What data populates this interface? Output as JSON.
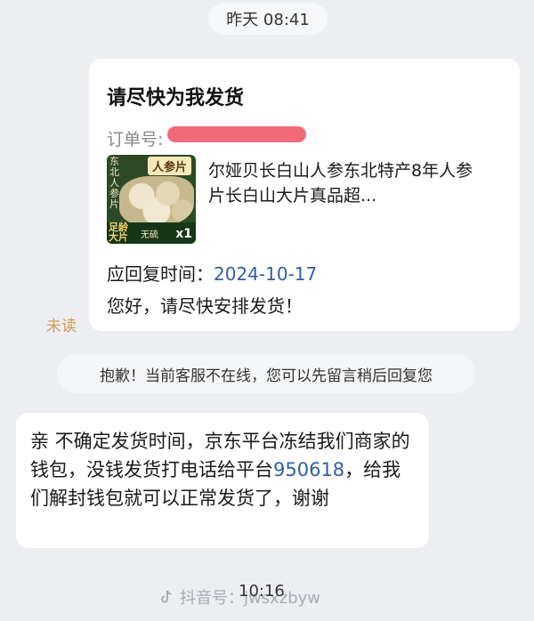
{
  "timestamps": {
    "top": "昨天 08:41",
    "bottom": "10:16"
  },
  "order_card": {
    "title": "请尽快为我发货",
    "order_label": "订单号:",
    "product_name": "尔娅贝长白山人参东北特产8年人参片长白山大片真品超...",
    "thumbnail": {
      "tag": "人参片",
      "side_text": "东北人参片",
      "big_text": "足龄大片",
      "badge": "无硫",
      "qty": "x1"
    },
    "reply_time_label": "应回复时间：",
    "reply_time_value": "2024-10-17",
    "greeting": "您好，请尽快安排发货！"
  },
  "unread_label": "未读",
  "system_notice": "抱歉！当前客服不在线，您可以先留言稍后回复您",
  "merchant_message": {
    "text_before": "亲  不确定发货时间，京东平台冻结我们商家的钱包，没钱发货打电话给平台",
    "phone": "950618",
    "text_after": "，给我们解封钱包就可以正常发货了，谢谢"
  },
  "watermark": "抖音号：jwsxzbyw",
  "colors": {
    "link_blue": "#2f5ea8",
    "unread_orange": "#d99a52",
    "redaction": "#f05a6a"
  }
}
